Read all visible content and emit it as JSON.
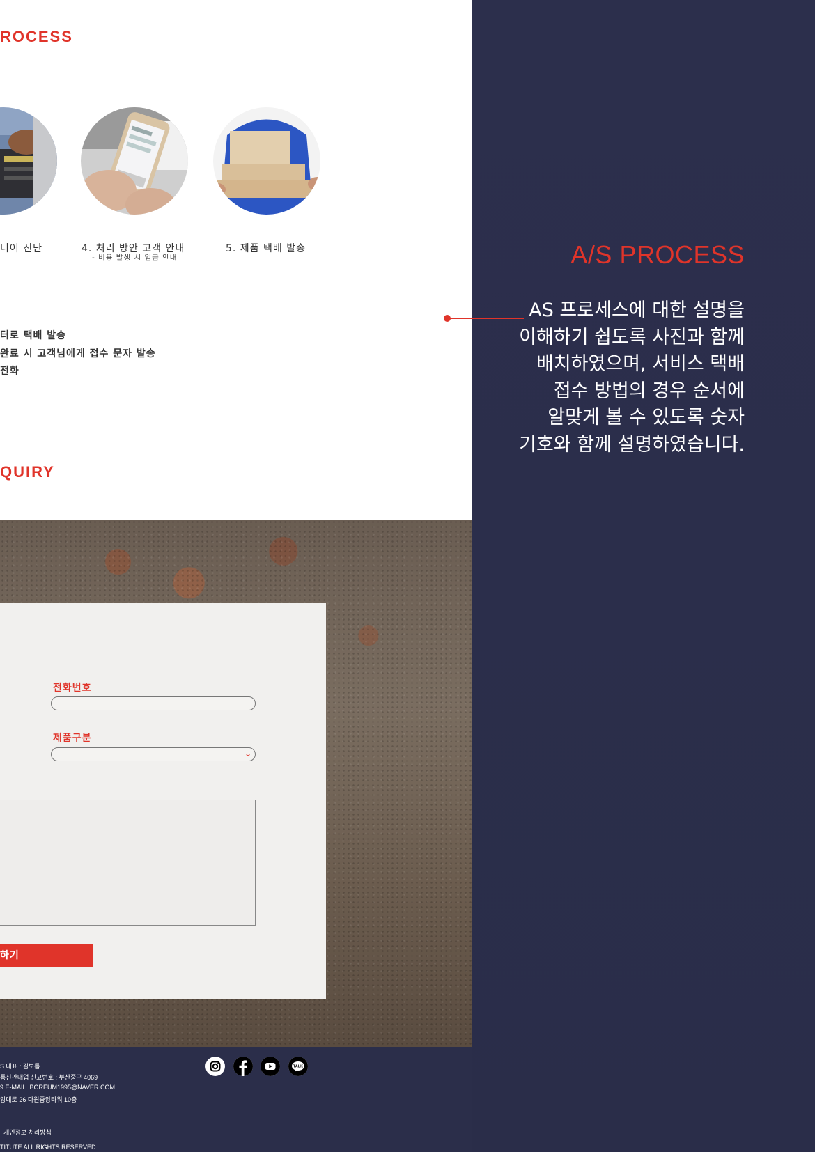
{
  "left_page": {
    "process_title": "ROCESS",
    "steps": [
      {
        "label": "니어 진단",
        "sub": ""
      },
      {
        "label": "4. 처리 방안 고객 안내",
        "sub": "- 비용 발생 시 입금 안내"
      },
      {
        "label": "5. 제품 택배 발송",
        "sub": ""
      }
    ],
    "notes": [
      "터로 택배 발송",
      "완료 시 고객님에게 접수 문자 발송",
      "전화"
    ],
    "inquiry_title": "QUIRY",
    "form": {
      "phone_label": "전화번호",
      "product_label": "제품구분",
      "submit_label": "하기"
    },
    "footer": {
      "lines": [
        "S  대표 : 김보름",
        "통신판매업 신고번호 : 부산중구 4069",
        "9  E-MAIL. BOREUM1995@NAVER.COM",
        "앙대로 26 다원중앙타워 10층"
      ],
      "privacy": "개인정보 처리방침",
      "copyright": "TITUTE ALL RIGHTS RESERVED."
    },
    "social_icons": [
      "instagram-icon",
      "facebook-icon",
      "youtube-icon",
      "kakaotalk-icon"
    ],
    "social_talk_text": "TALK"
  },
  "panel": {
    "title": "A/S PROCESS",
    "description": "AS 프로세스에 대한 설명을 이해하기 쉽도록 사진과 함께 배치하였으며, 서비스 택배 접수 방법의 경우 순서에 알맞게 볼 수 있도록 숫자 기호와 함께 설명하였습니다."
  },
  "colors": {
    "accent": "#e0342a",
    "panel_bg": "#2c2f4c",
    "footer_bg": "#2b2e4a"
  }
}
